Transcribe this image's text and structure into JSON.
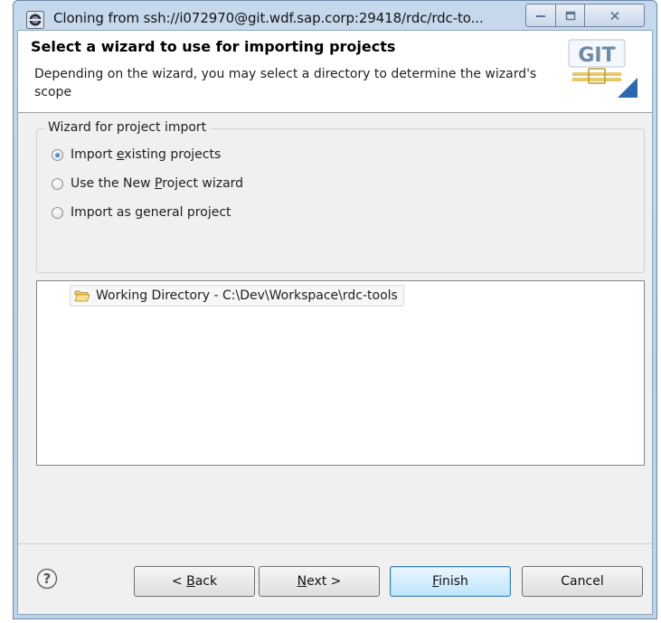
{
  "window": {
    "title": "Cloning from ssh://i072970@git.wdf.sap.corp:29418/rdc/rdc-to..."
  },
  "header": {
    "title": "Select a wizard to use for importing projects",
    "description": "Depending on the wizard, you may select a directory to determine the wizard's scope",
    "logo_text": "GIT"
  },
  "wizard_group": {
    "legend": "Wizard for project import",
    "options": [
      {
        "pre": "Import ",
        "mnemonic": "e",
        "post": "xisting projects",
        "checked": true
      },
      {
        "pre": "Use the New ",
        "mnemonic": "P",
        "post": "roject wizard",
        "checked": false
      },
      {
        "pre": "Import as ",
        "mnemonic": "g",
        "post": "eneral project",
        "checked": false
      }
    ]
  },
  "tree": {
    "items": [
      {
        "label": "Working Directory - C:\\Dev\\Workspace\\rdc-tools",
        "icon": "folder-open-icon"
      }
    ]
  },
  "buttons": {
    "back": {
      "pre": "< ",
      "mnemonic": "B",
      "post": "ack"
    },
    "next": {
      "pre": "",
      "mnemonic": "N",
      "post": "ext >"
    },
    "finish": {
      "pre": "",
      "mnemonic": "F",
      "post": "inish"
    },
    "cancel": "Cancel"
  },
  "colors": {
    "titlebar": "#c6d9ec",
    "dialog_bg": "#f0f0f0",
    "default_button": "#bee6fd"
  }
}
